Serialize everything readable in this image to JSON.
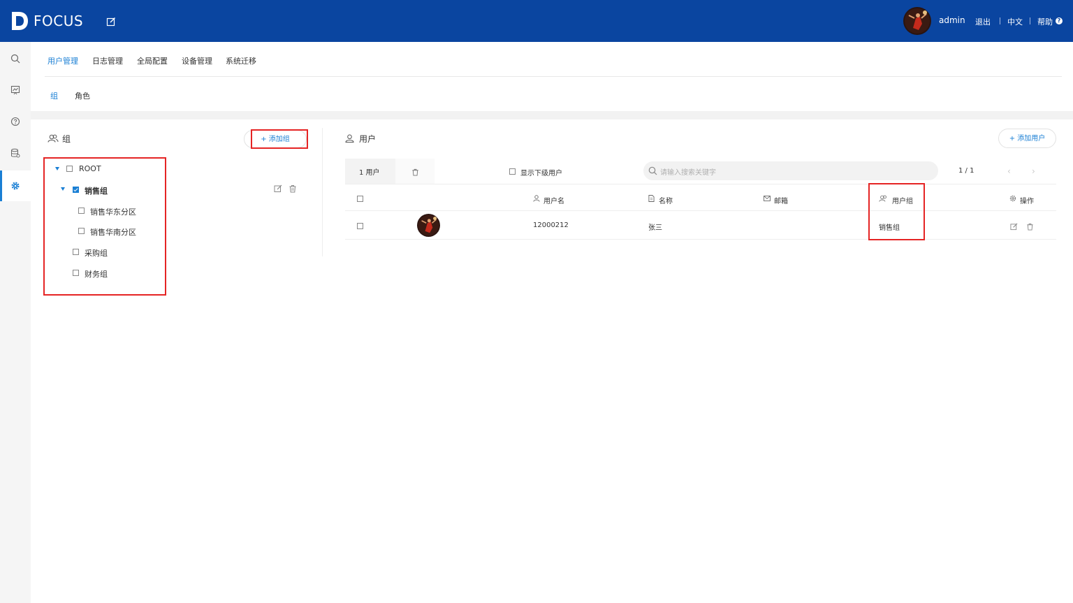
{
  "header": {
    "app_name": "FOCUS",
    "user": "admin",
    "logout": "退出",
    "language": "中文",
    "help": "帮助",
    "help_glyph": "?",
    "bg_color": "#0a45a0"
  },
  "sidebar": {
    "items": [
      {
        "icon": "search-icon"
      },
      {
        "icon": "dashboard-icon"
      },
      {
        "icon": "help-circle-icon"
      },
      {
        "icon": "database-icon"
      },
      {
        "icon": "gear-icon",
        "active": true
      }
    ]
  },
  "top_tabs": [
    "用户管理",
    "日志管理",
    "全局配置",
    "设备管理",
    "系统迁移"
  ],
  "sub_tabs": [
    "组",
    "角色"
  ],
  "group_panel": {
    "title": "组",
    "add_button": "+ 添加组",
    "tree": [
      {
        "label": "ROOT",
        "checked": false,
        "expanded": true
      },
      {
        "label": "销售组",
        "checked": true,
        "expanded": true
      },
      {
        "label": "销售华东分区",
        "checked": false
      },
      {
        "label": "销售华南分区",
        "checked": false
      },
      {
        "label": "采购组",
        "checked": false
      },
      {
        "label": "财务组",
        "checked": false
      }
    ]
  },
  "user_panel": {
    "title": "用户",
    "add_button": "+ 添加用户",
    "count_tab": "1 用户",
    "show_sub_users": "显示下级用户",
    "search_placeholder": "请输入搜索关键字",
    "pager": "1 / 1",
    "columns": [
      "用户名",
      "名称",
      "邮箱",
      "用户组",
      "操作"
    ],
    "rows": [
      {
        "username": "12000212",
        "name": "张三",
        "email": "",
        "group": "销售组"
      }
    ]
  },
  "colors": {
    "accent": "#1a7fd4",
    "highlight_box": "#e52424"
  }
}
